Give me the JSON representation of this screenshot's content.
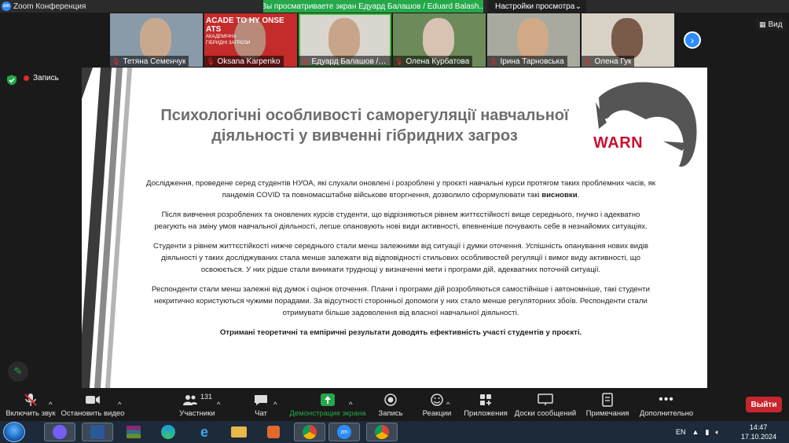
{
  "window": {
    "title": "Zoom Конференция",
    "share_banner": "Вы просматриваете экран Едуард Балашов / Eduard Balash...",
    "view_options_label": "Настройки просмотра",
    "view_button": "Вид"
  },
  "participants": [
    {
      "name": "Тетяна Семенчук",
      "muted": true,
      "active": false,
      "bg": "#8a9aa8",
      "face": "#c9a98e"
    },
    {
      "name": "Oksana Karpenko",
      "muted": true,
      "active": false,
      "bg": "#c42b2b",
      "face": "#b98a78",
      "overlay_lines": [
        "ACADE",
        "TO HY",
        "ONSE",
        "ATS"
      ],
      "overlay_sub": [
        "АКАДЕМІЧНА",
        "ГІБРИДНІ ЗАГРОЗИ"
      ]
    },
    {
      "name": "Едуард Балашов / Eduard Balashov",
      "muted": true,
      "active": true,
      "bg": "#d9d6cf",
      "face": "#c8a58a"
    },
    {
      "name": "Олена Курбатова",
      "muted": true,
      "active": false,
      "bg": "#6d8b5a",
      "face": "#d8c2b2"
    },
    {
      "name": "Ірина Тарновська",
      "muted": true,
      "active": false,
      "bg": "#a8aaa0",
      "face": "#d2a987"
    },
    {
      "name": "Олена Гук",
      "muted": true,
      "active": false,
      "bg": "#d8d2c6",
      "face": "#7a5a48"
    }
  ],
  "recording": {
    "label": "Запись"
  },
  "slide": {
    "title_line1": "Психологічні особливості саморегуляції навчальної",
    "title_line2": "діяльності у вивченні гібридних загроз",
    "logo_text": "WARN",
    "p1_a": "Дослідження, проведене серед студентів НУОА, які слухали оновлені і розроблені у проєкті навчальні курси протягом таких проблемних часів, як пандемія COVID та повномасштабне військове вторгнення, дозволило сформулювати такі ",
    "p1_b": "висновки",
    "p1_c": ".",
    "p2": "Після вивчення розроблених та оновлених курсів студенти, що відрізняються рівнем життєстійкості вище середнього, гнучко і адекватно реагують на зміну умов навчальної діяльності, легше опановують нові види активності, впевненіше почувають себе в незнайомих ситуаціях.",
    "p3": "Студенти з рівнем життєстійкості нижче середнього стали менш залежними від ситуації і думки оточення. Успішність опанування нових видів діяльності у таких досліджуваних стала менше залежати від відповідності стильових особливостей регуляції і вимог виду активності, що освоюється. У них рідше стали виникати труднощі у визначенні мети і програми дій, адекватних поточній ситуації.",
    "p4": "Респонденти стали менш залежні від думок і оцінок оточення. Плани і програми дій розробляються самостійніше і автономніше, такі студенти некритично користуються чужими порадами. За відсутності сторонньої допомоги у них стало менше регуляторних збоїв. Респонденти стали отримувати більше задоволення від власної навчальної діяльності.",
    "p5": "Отримані теоретичні та емпіричні результати доводять ефективність участі студентів у проєкті."
  },
  "toolbar": {
    "mute": "Включить звук",
    "video": "Остановить видео",
    "participants": "Участники",
    "participants_count": "131",
    "chat": "Чат",
    "share": "Демонстрация экрана",
    "record": "Запись",
    "reactions": "Реакции",
    "apps": "Приложения",
    "whiteboards": "Доски сообщений",
    "notes": "Примечания",
    "more": "Дополнительно",
    "leave": "Выйти"
  },
  "taskbar": {
    "language": "EN",
    "time": "14:47",
    "date": "17.10.2024"
  },
  "colors": {
    "zoom_blue": "#2d8cff",
    "share_green": "#24a84a",
    "leave_red": "#c8262d",
    "warn_red": "#c8102e"
  }
}
